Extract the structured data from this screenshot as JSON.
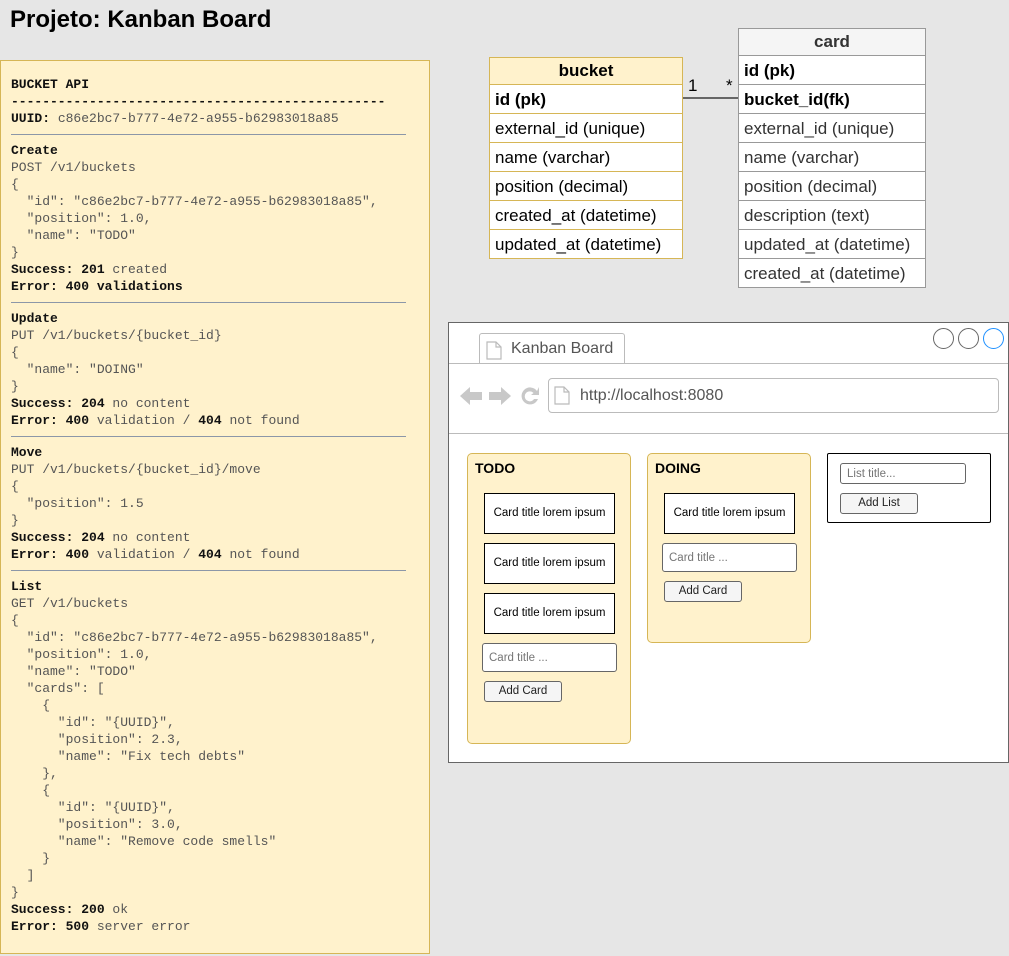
{
  "page": {
    "title": "Projeto: Kanban Board"
  },
  "doc": {
    "heading": "BUCKET API",
    "dashes": "------------------------------------------------",
    "uuid_label": "UUID:",
    "uuid_value": " c86e2bc7-b777-4e72-a955-b62983018a85",
    "sections": [
      {
        "title": "Create",
        "request": "POST /v1/buckets",
        "body": [
          "{",
          "  \"id\": \"c86e2bc7-b777-4e72-a955-b62983018a85\",",
          "  \"position\": 1.0,",
          "  \"name\": \"TODO\"",
          "}"
        ],
        "success_label": "Success: 201",
        "success_text": " created",
        "error_label": "Error: 400 validations",
        "error_text": "",
        "error_code2": "",
        "error_text2": ""
      },
      {
        "title": "Update",
        "request": "PUT /v1/buckets/{bucket_id}",
        "body": [
          "{",
          "  \"name\": \"DOING\"",
          "}"
        ],
        "success_label": "Success: 204",
        "success_text": " no content",
        "error_label": "Error: 400",
        "error_text": " validation / ",
        "error_code2": "404",
        "error_text2": " not found"
      },
      {
        "title": "Move",
        "request": "PUT /v1/buckets/{bucket_id}/move",
        "body": [
          "{",
          "  \"position\": 1.5",
          "}"
        ],
        "success_label": "Success: 204",
        "success_text": " no content",
        "error_label": "Error: 400",
        "error_text": " validation / ",
        "error_code2": "404",
        "error_text2": " not found"
      },
      {
        "title": "List",
        "request": "GET /v1/buckets",
        "body": [
          "{",
          "  \"id\": \"c86e2bc7-b777-4e72-a955-b62983018a85\",",
          "  \"position\": 1.0,",
          "  \"name\": \"TODO\"",
          "  \"cards\": [",
          "    {",
          "      \"id\": \"{UUID}\",",
          "      \"position\": 2.3,",
          "      \"name\": \"Fix tech debts\"",
          "    },",
          "    {",
          "      \"id\": \"{UUID}\",",
          "      \"position\": 3.0,",
          "      \"name\": \"Remove code smells\"",
          "    }",
          "  ]",
          "}"
        ],
        "success_label": "Success: 200",
        "success_text": " ok",
        "error_label": "Error: 500",
        "error_text": " server error",
        "error_code2": "",
        "error_text2": ""
      }
    ]
  },
  "er": {
    "bucket": {
      "name": "bucket",
      "fields": [
        "id (pk)",
        "external_id (unique)",
        "name (varchar)",
        "position (decimal)",
        "created_at (datetime)",
        "updated_at (datetime)"
      ]
    },
    "card": {
      "name": "card",
      "fields": [
        "id (pk)",
        "bucket_id(fk)",
        "external_id (unique)",
        "name (varchar)",
        "position (decimal)",
        "description (text)",
        "updated_at (datetime)",
        "created_at (datetime)"
      ]
    },
    "relation": {
      "one": "1",
      "many": "*"
    }
  },
  "browser": {
    "tab_title": "Kanban Board",
    "url": "http://localhost:8080",
    "colors": {
      "accent": "#1e90ff",
      "list_bg": "#fff2cc",
      "list_border": "#d6b656"
    },
    "lists": [
      {
        "title": "TODO",
        "cards": [
          "Card title lorem ipsum",
          "Card title lorem ipsum",
          "Card title lorem ipsum"
        ],
        "input_placeholder": "Card title ...",
        "button": "Add Card"
      },
      {
        "title": "DOING",
        "cards": [
          "Card title lorem ipsum"
        ],
        "input_placeholder": "Card title ...",
        "button": "Add Card"
      }
    ],
    "new_list": {
      "input_placeholder": "List title...",
      "button": "Add List"
    }
  }
}
